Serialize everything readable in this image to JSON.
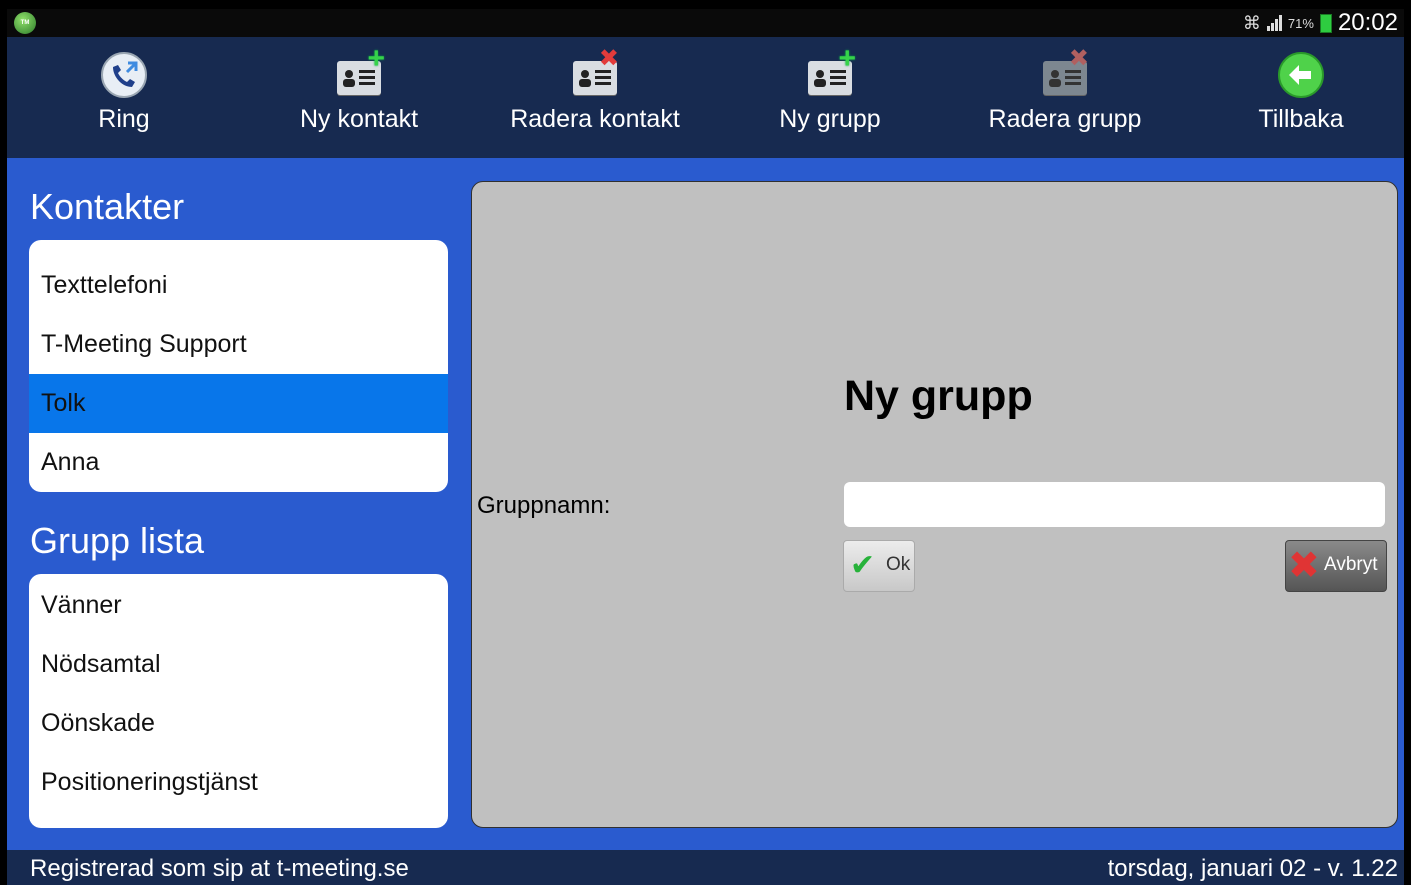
{
  "statusbar": {
    "app_badge": "T-Meeting",
    "battery_pct": "71%",
    "time": "20:02",
    "icons": [
      "wifi-icon",
      "signal-icon",
      "battery-icon"
    ]
  },
  "toolbar": {
    "items": [
      {
        "label": "Ring",
        "icon": "phone-icon"
      },
      {
        "label": "Ny kontakt",
        "icon": "add-contact-icon"
      },
      {
        "label": "Radera kontakt",
        "icon": "delete-contact-icon"
      },
      {
        "label": "Ny grupp",
        "icon": "add-group-icon"
      },
      {
        "label": "Radera grupp",
        "icon": "delete-group-icon"
      },
      {
        "label": "Tillbaka",
        "icon": "back-arrow-icon"
      }
    ]
  },
  "contacts": {
    "title": "Kontakter",
    "items": [
      "Texttelefoni",
      "T-Meeting Support",
      "Tolk",
      "Anna"
    ],
    "selected": "Tolk"
  },
  "groups": {
    "title": "Grupp lista",
    "items": [
      "Vänner",
      "Nödsamtal",
      "Oönskade",
      "Positioneringstjänst"
    ]
  },
  "dialog": {
    "title": "Ny grupp",
    "field_label": "Gruppnamn:",
    "field_value": "",
    "ok_label": "Ok",
    "cancel_label": "Avbryt"
  },
  "footer": {
    "left": "Registrerad som sip at t-meeting.se",
    "right": "torsdag, januari 02 - v. 1.22"
  },
  "colors": {
    "toolbar_bg": "#172a50",
    "main_bg": "#2a5bcf",
    "selected_bg": "#0876ea",
    "panel_bg": "#c0c0c0"
  }
}
